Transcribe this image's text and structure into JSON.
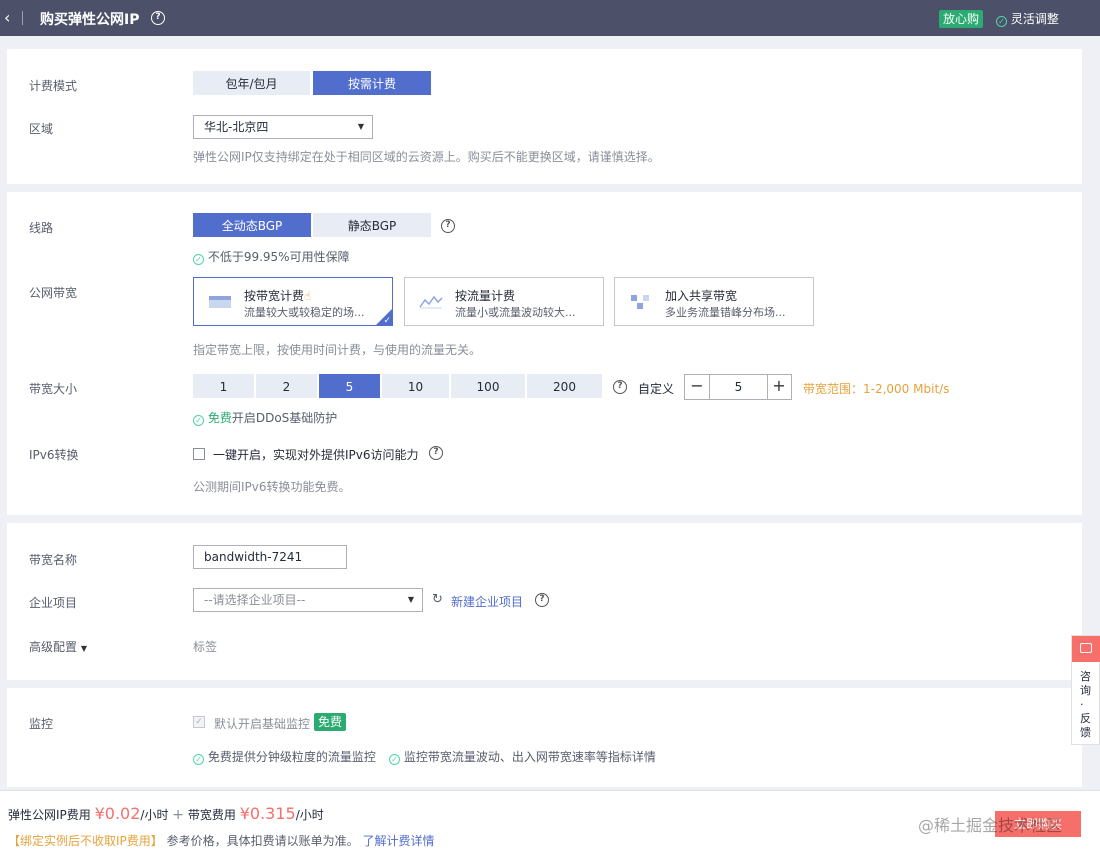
{
  "header": {
    "back_icon": "‹",
    "title": "购买弹性公网IP",
    "help_icon": "?",
    "badge": "放心购",
    "flex_label": "灵活调整"
  },
  "billing": {
    "label": "计费模式",
    "options": [
      "包年/包月",
      "按需计费"
    ],
    "selected": "按需计费"
  },
  "region": {
    "label": "区域",
    "value": "华北-北京四",
    "hint": "弹性公网IP仅支持绑定在处于相同区域的云资源上。购买后不能更换区域，请谨慎选择。"
  },
  "line": {
    "label": "线路",
    "options": [
      "全动态BGP",
      "静态BGP"
    ],
    "selected": "全动态BGP",
    "note": "不低于99.95%可用性保障"
  },
  "bandwidth_type": {
    "label": "公网带宽",
    "cards": [
      {
        "title": "按带宽计费",
        "sub": "流量较大或较稳定的场...",
        "selected": true,
        "icon": "bandwidth-icon"
      },
      {
        "title": "按流量计费",
        "sub": "流量小或流量波动较大...",
        "selected": false,
        "icon": "traffic-icon"
      },
      {
        "title": "加入共享带宽",
        "sub": "多业务流量错峰分布场...",
        "selected": false,
        "icon": "shared-icon"
      }
    ],
    "hint": "指定带宽上限，按使用时间计费，与使用的流量无关。"
  },
  "bandwidth_size": {
    "label": "带宽大小",
    "options": [
      "1",
      "2",
      "5",
      "10",
      "100",
      "200"
    ],
    "selected": "5",
    "custom_label": "自定义",
    "custom_value": "5",
    "minus": "−",
    "plus": "+",
    "range": "带宽范围：1-2,000 Mbit/s",
    "free_word": "免费",
    "ddos_note": "开启DDoS基础防护"
  },
  "ipv6": {
    "label": "IPv6转换",
    "checkbox_label": "一键开启，实现对外提供IPv6访问能力",
    "hint": "公测期间IPv6转换功能免费。"
  },
  "name": {
    "label": "带宽名称",
    "value": "bandwidth-7241"
  },
  "project": {
    "label": "企业项目",
    "placeholder": "--请选择企业项目--",
    "new_link": "新建企业项目"
  },
  "advanced": {
    "label": "高级配置",
    "tag": "标签"
  },
  "monitor": {
    "label": "监控",
    "checkbox_label": "默认开启基础监控",
    "free_badge": "免费",
    "note1": "免费提供分钟级粒度的流量监控",
    "note2": "监控带宽流量波动、出入网带宽速率等指标详情"
  },
  "sidebar": {
    "text": "咨询·反馈"
  },
  "footer": {
    "ip_fee_label": "弹性公网IP费用",
    "ip_price": "¥0.02",
    "per_hour": "/小时",
    "plus": "+",
    "bw_fee_label": "带宽费用",
    "bw_price": "¥0.315",
    "warning": "【绑定实例后不收取IP费用】",
    "ref_text": "参考价格，具体扣费请以账单为准。",
    "detail_link": "了解计费详情",
    "buy_button": "立即购买",
    "watermark": "@稀土掘金技术社区"
  },
  "colors": {
    "primary": "#526ecc",
    "header_bg": "#4c5068",
    "price_red": "#f66f6a",
    "success_green": "#2bab71",
    "warning_orange": "#e6a23c"
  }
}
